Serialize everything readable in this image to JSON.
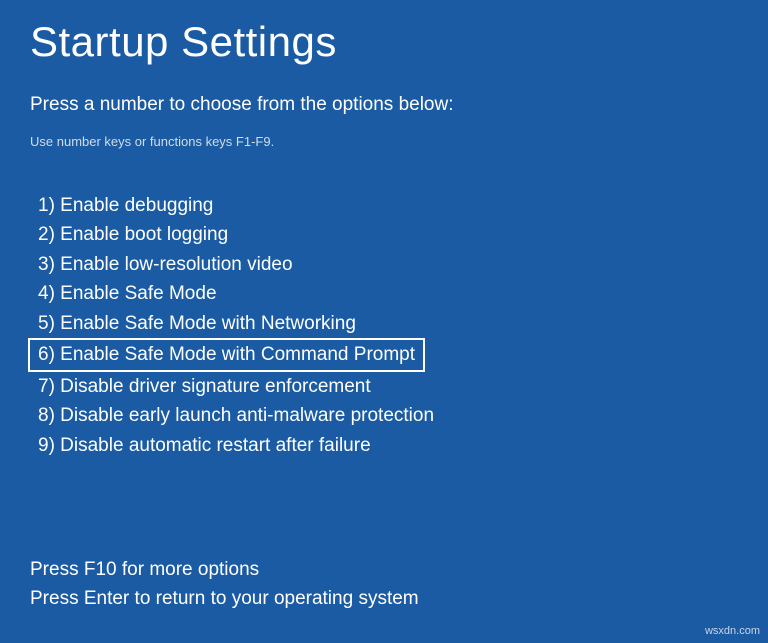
{
  "title": "Startup Settings",
  "instruction": "Press a number to choose from the options below:",
  "hint": "Use number keys or functions keys F1-F9.",
  "options": [
    {
      "num": "1",
      "label": "Enable debugging",
      "highlighted": false
    },
    {
      "num": "2",
      "label": "Enable boot logging",
      "highlighted": false
    },
    {
      "num": "3",
      "label": "Enable low-resolution video",
      "highlighted": false
    },
    {
      "num": "4",
      "label": "Enable Safe Mode",
      "highlighted": false
    },
    {
      "num": "5",
      "label": "Enable Safe Mode with Networking",
      "highlighted": false
    },
    {
      "num": "6",
      "label": "Enable Safe Mode with Command Prompt",
      "highlighted": true
    },
    {
      "num": "7",
      "label": "Disable driver signature enforcement",
      "highlighted": false
    },
    {
      "num": "8",
      "label": "Disable early launch anti-malware protection",
      "highlighted": false
    },
    {
      "num": "9",
      "label": "Disable automatic restart after failure",
      "highlighted": false
    }
  ],
  "footer": {
    "more": "Press F10 for more options",
    "return": "Press Enter to return to your operating system"
  },
  "watermark": "wsxdn.com"
}
